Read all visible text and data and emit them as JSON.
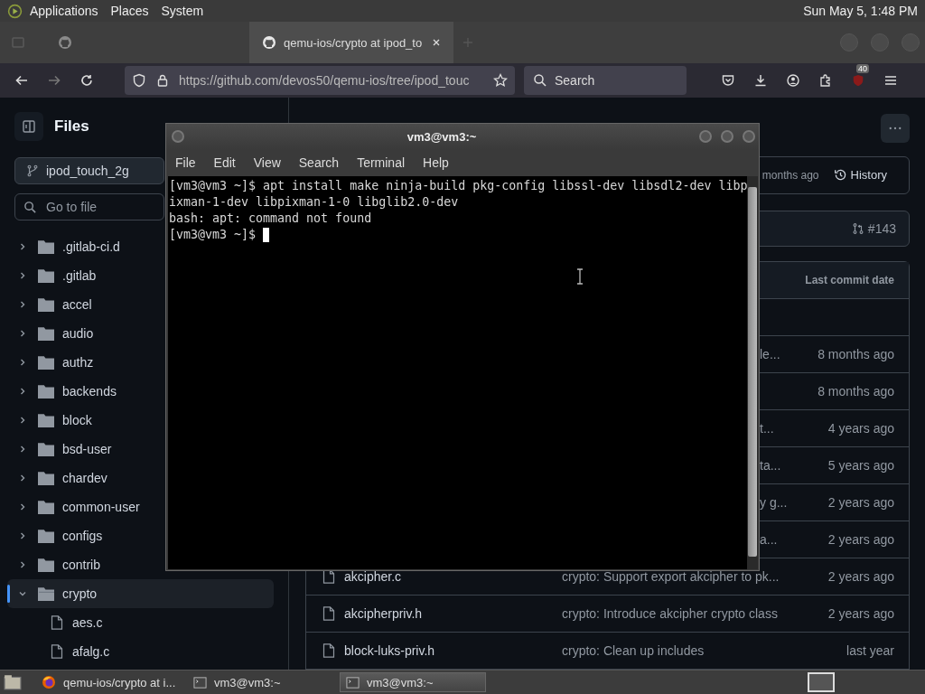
{
  "top_panel": {
    "menus": [
      "Applications",
      "Places",
      "System"
    ],
    "clock": "Sun May 5, 1:48 PM"
  },
  "browser": {
    "tabs": [
      {
        "selected": false
      },
      {
        "title": "qemu-ios/crypto at ipod_to",
        "selected": true
      }
    ],
    "url": "https://github.com/devos50/qemu-ios/tree/ipod_touc",
    "search": {
      "placeholder": "Search"
    },
    "extension_badge": "40"
  },
  "sidebar": {
    "title": "Files",
    "branch": "ipod_touch_2g",
    "search": {
      "placeholder": "Go to file"
    },
    "tree": [
      {
        "name": ".gitlab-ci.d",
        "kind": "folder",
        "expanded": false,
        "selected": false
      },
      {
        "name": ".gitlab",
        "kind": "folder",
        "expanded": false,
        "selected": false
      },
      {
        "name": "accel",
        "kind": "folder",
        "expanded": false,
        "selected": false
      },
      {
        "name": "audio",
        "kind": "folder",
        "expanded": false,
        "selected": false
      },
      {
        "name": "authz",
        "kind": "folder",
        "expanded": false,
        "selected": false
      },
      {
        "name": "backends",
        "kind": "folder",
        "expanded": false,
        "selected": false
      },
      {
        "name": "block",
        "kind": "folder",
        "expanded": false,
        "selected": false
      },
      {
        "name": "bsd-user",
        "kind": "folder",
        "expanded": false,
        "selected": false
      },
      {
        "name": "chardev",
        "kind": "folder",
        "expanded": false,
        "selected": false
      },
      {
        "name": "common-user",
        "kind": "folder",
        "expanded": false,
        "selected": false
      },
      {
        "name": "configs",
        "kind": "folder",
        "expanded": false,
        "selected": false
      },
      {
        "name": "contrib",
        "kind": "folder",
        "expanded": false,
        "selected": false
      },
      {
        "name": "crypto",
        "kind": "folder",
        "expanded": true,
        "selected": true,
        "children": [
          {
            "name": "aes.c",
            "kind": "file",
            "selected": false
          },
          {
            "name": "afalg.c",
            "kind": "file",
            "selected": false
          }
        ]
      }
    ]
  },
  "main": {
    "commit_bar": {
      "age": "months ago",
      "history": "History"
    },
    "pr_bar": {
      "number": "#143"
    },
    "table": {
      "date_header": "Last commit date",
      "rows": [
        {
          "message": "le...",
          "date": "8 months ago"
        },
        {
          "date": "8 months ago"
        },
        {
          "message": "t...",
          "date": "4 years ago"
        },
        {
          "message": "ta...",
          "date": "5 years ago"
        },
        {
          "message": "y g...",
          "date": "2 years ago"
        },
        {
          "message": "a...",
          "date": "2 years ago"
        },
        {
          "name": "akcipher.c",
          "message": "crypto: Support export akcipher to pk...",
          "date": "2 years ago"
        },
        {
          "name": "akcipherpriv.h",
          "message": "crypto: Introduce akcipher crypto class",
          "date": "2 years ago"
        },
        {
          "name": "block-luks-priv.h",
          "message": "crypto: Clean up includes",
          "date": "last year"
        }
      ]
    }
  },
  "terminal": {
    "title": "vm3@vm3:~",
    "menus": [
      "File",
      "Edit",
      "View",
      "Search",
      "Terminal",
      "Help"
    ],
    "lines": [
      "[vm3@vm3 ~]$ apt install make ninja-build pkg-config libssl-dev libsdl2-dev libp",
      "ixman-1-dev libpixman-1-0 libglib2.0-dev",
      "bash: apt: command not found",
      "[vm3@vm3 ~]$"
    ]
  },
  "taskbar": {
    "items": [
      {
        "label": "qemu-ios/crypto at i...",
        "kind": "browser",
        "selected": false
      },
      {
        "label": "vm3@vm3:~",
        "kind": "terminal",
        "selected": false
      },
      {
        "label": "vm3@vm3:~",
        "kind": "terminal",
        "selected": true
      }
    ]
  }
}
